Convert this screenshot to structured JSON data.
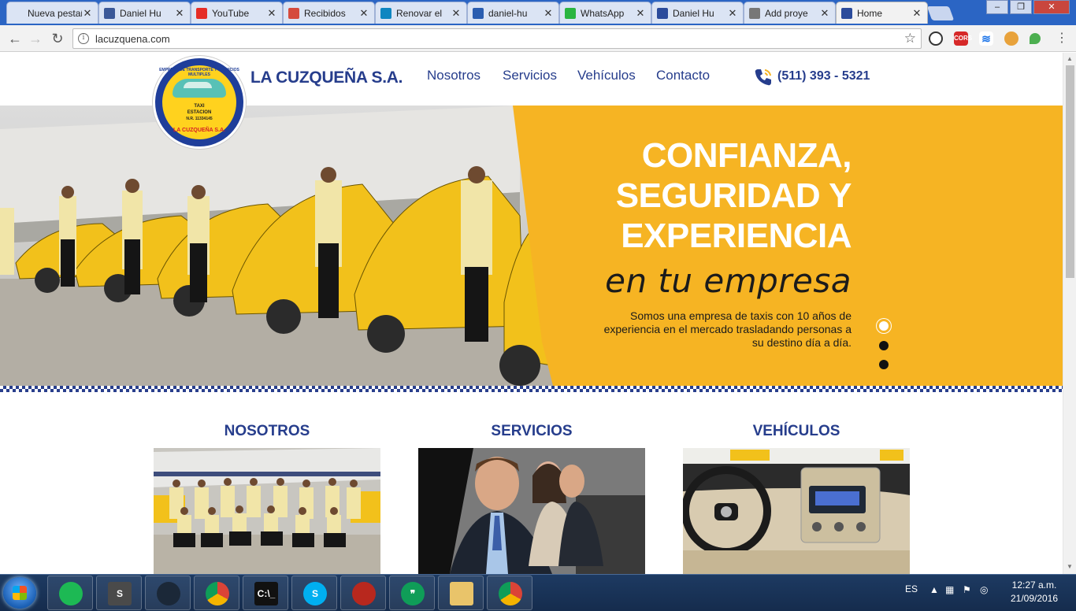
{
  "browser": {
    "tabs": [
      {
        "label": "Nueva pestaña",
        "icon": "blank-page-icon",
        "color": "#dbe4f4"
      },
      {
        "label": "Daniel Hu",
        "icon": "facebook-icon",
        "color": "#3b5998"
      },
      {
        "label": "YouTube",
        "icon": "youtube-icon",
        "color": "#e52d27"
      },
      {
        "label": "Recibidos",
        "icon": "gmail-icon",
        "color": "#d54b3d"
      },
      {
        "label": "Renovar el",
        "icon": "n-app-icon",
        "color": "#0f86c1"
      },
      {
        "label": "daniel-hu",
        "icon": "github-icon",
        "color": "#2a5db0"
      },
      {
        "label": "WhatsApp",
        "icon": "whatsapp-icon",
        "color": "#2ab540"
      },
      {
        "label": "Daniel Hu",
        "icon": "car-icon",
        "color": "#2b4b9b"
      },
      {
        "label": "Add proye",
        "icon": "document-icon",
        "color": "#777777"
      },
      {
        "label": "Home",
        "icon": "car-icon",
        "color": "#2b4b9b"
      }
    ],
    "url": "lacuzquena.com",
    "window_controls": {
      "minimize": "–",
      "maximize": "❐",
      "close": "✕"
    }
  },
  "site": {
    "brand": "LA CUZQUEÑA S.A.",
    "logo": {
      "top_text": "EMPRESA DE TRANSPORTE Y SERVICIOS MULTIPLES",
      "line1": "TAXI",
      "line2": "ESTACION",
      "line3": "N.R. 11334145",
      "bottom_text": "LA CUZQUEÑA S.A."
    },
    "nav": [
      "Nosotros",
      "Servicios",
      "Vehículos",
      "Contacto"
    ],
    "phone": "(511) 393 - 5321",
    "accent": "#f6b423",
    "brand_blue": "#263d8c"
  },
  "hero": {
    "title_lines": [
      "CONFIANZA,",
      "SEGURIDAD Y",
      "EXPERIENCIA"
    ],
    "subtitle": "en tu empresa",
    "description": "Somos una empresa de taxis con 10 años de experiencia en el mercado trasladando personas a su destino día a día.",
    "slides": 3,
    "active_slide": 1
  },
  "sections": [
    {
      "title": "NOSOTROS",
      "image": "team-photo"
    },
    {
      "title": "SERVICIOS",
      "image": "passengers-photo"
    },
    {
      "title": "VEHÍCULOS",
      "image": "dashboard-photo"
    }
  ],
  "taskbar": {
    "apps": [
      {
        "name": "spotify-icon",
        "glyph": "",
        "color": "#1db954"
      },
      {
        "name": "sublime-text-icon",
        "glyph": "S",
        "color": "#4a4a4a"
      },
      {
        "name": "steam-icon",
        "glyph": "",
        "color": "#1b2838"
      },
      {
        "name": "chrome-icon",
        "glyph": "",
        "color": "#dd4b39"
      },
      {
        "name": "command-prompt-icon",
        "glyph": "C:\\_",
        "color": "#111111"
      },
      {
        "name": "skype-icon",
        "glyph": "S",
        "color": "#00aff0"
      },
      {
        "name": "dota-icon",
        "glyph": "",
        "color": "#b8281e"
      },
      {
        "name": "hangouts-icon",
        "glyph": "❞",
        "color": "#0f9d58"
      },
      {
        "name": "file-explorer-icon",
        "glyph": "",
        "color": "#e9c46a"
      },
      {
        "name": "chrome-icon",
        "glyph": "",
        "color": "#dd4b39"
      }
    ],
    "language": "ES",
    "time": "12:27 a.m.",
    "date": "21/09/2016"
  }
}
